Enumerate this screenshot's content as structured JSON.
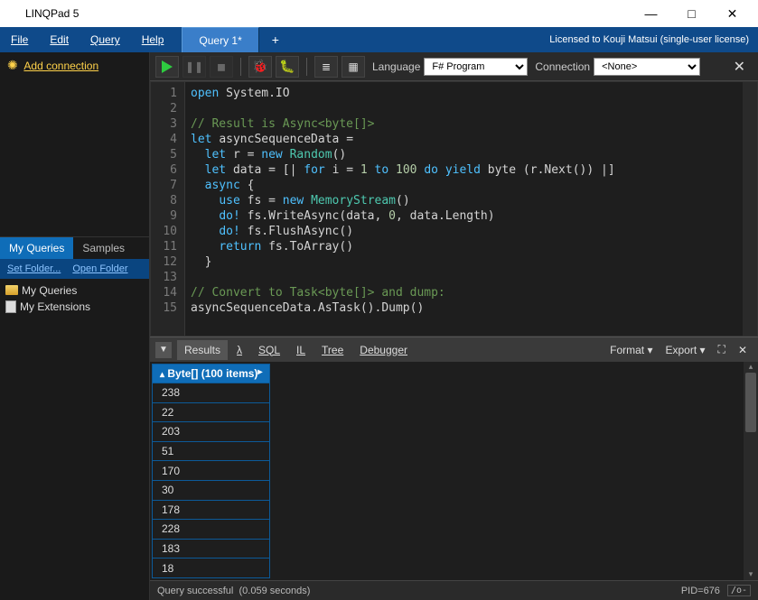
{
  "title": "LINQPad 5",
  "menu": {
    "file": "File",
    "edit": "Edit",
    "query": "Query",
    "help": "Help"
  },
  "tabs": {
    "active": "Query 1*",
    "newtab": "+"
  },
  "license": "Licensed to Kouji Matsui (single-user license)",
  "sidebar": {
    "add_connection": "Add connection",
    "tabs": {
      "my_queries": "My Queries",
      "samples": "Samples"
    },
    "folder_links": {
      "set": "Set Folder...",
      "open": "Open Folder"
    },
    "tree": {
      "my_queries": "My Queries",
      "my_extensions": "My Extensions"
    }
  },
  "toolbar": {
    "language_label": "Language",
    "language_value": "F# Program",
    "connection_label": "Connection",
    "connection_value": "<None>"
  },
  "code": {
    "lines": [
      {
        "n": 1,
        "html": "<span class='kw'>open</span> <span class='pl'>System.IO</span>"
      },
      {
        "n": 2,
        "html": ""
      },
      {
        "n": 3,
        "html": "<span class='com'>// Result is Async&lt;byte[]&gt;</span>"
      },
      {
        "n": 4,
        "html": "<span class='kw'>let</span> <span class='pl'>asyncSequenceData =</span>"
      },
      {
        "n": 5,
        "html": "  <span class='kw'>let</span> <span class='pl'>r =</span> <span class='kw'>new</span> <span class='typ'>Random</span><span class='pl'>()</span>"
      },
      {
        "n": 6,
        "html": "  <span class='kw'>let</span> <span class='pl'>data = [|</span> <span class='kw'>for</span> <span class='pl'>i =</span> <span class='num'>1</span> <span class='kw'>to</span> <span class='num'>100</span> <span class='kw'>do</span> <span class='kw'>yield</span> <span class='pl'>byte (r.Next()) |]</span>"
      },
      {
        "n": 7,
        "html": "  <span class='kw'>async</span> <span class='pl'>{</span>"
      },
      {
        "n": 8,
        "html": "    <span class='kw'>use</span> <span class='pl'>fs =</span> <span class='kw'>new</span> <span class='typ'>MemoryStream</span><span class='pl'>()</span>"
      },
      {
        "n": 9,
        "html": "    <span class='kw'>do!</span> <span class='pl'>fs.WriteAsync(data,</span> <span class='num'>0</span><span class='pl'>, data.Length)</span>"
      },
      {
        "n": 10,
        "html": "    <span class='kw'>do!</span> <span class='pl'>fs.FlushAsync()</span>"
      },
      {
        "n": 11,
        "html": "    <span class='kw'>return</span> <span class='pl'>fs.ToArray()</span>"
      },
      {
        "n": 12,
        "html": "  <span class='pl'>}</span>"
      },
      {
        "n": 13,
        "html": ""
      },
      {
        "n": 14,
        "html": "<span class='com'>// Convert to Task&lt;byte[]&gt; and dump:</span>"
      },
      {
        "n": 15,
        "html": "<span class='pl'>asyncSequenceData.AsTask().Dump()</span>"
      }
    ]
  },
  "results_header": {
    "tabs": {
      "results": "Results",
      "lambda": "λ",
      "sql": "SQL",
      "il": "IL",
      "tree": "Tree",
      "debug": "Debugger"
    },
    "format": "Format ▾",
    "export": "Export ▾"
  },
  "results": {
    "header": "Byte[] (100 items)",
    "rows": [
      "238",
      "22",
      "203",
      "51",
      "170",
      "30",
      "178",
      "228",
      "183",
      "18"
    ]
  },
  "status": {
    "msg": "Query successful",
    "time": "(0.059 seconds)",
    "pid": "PID=676",
    "grip": "/o-"
  }
}
